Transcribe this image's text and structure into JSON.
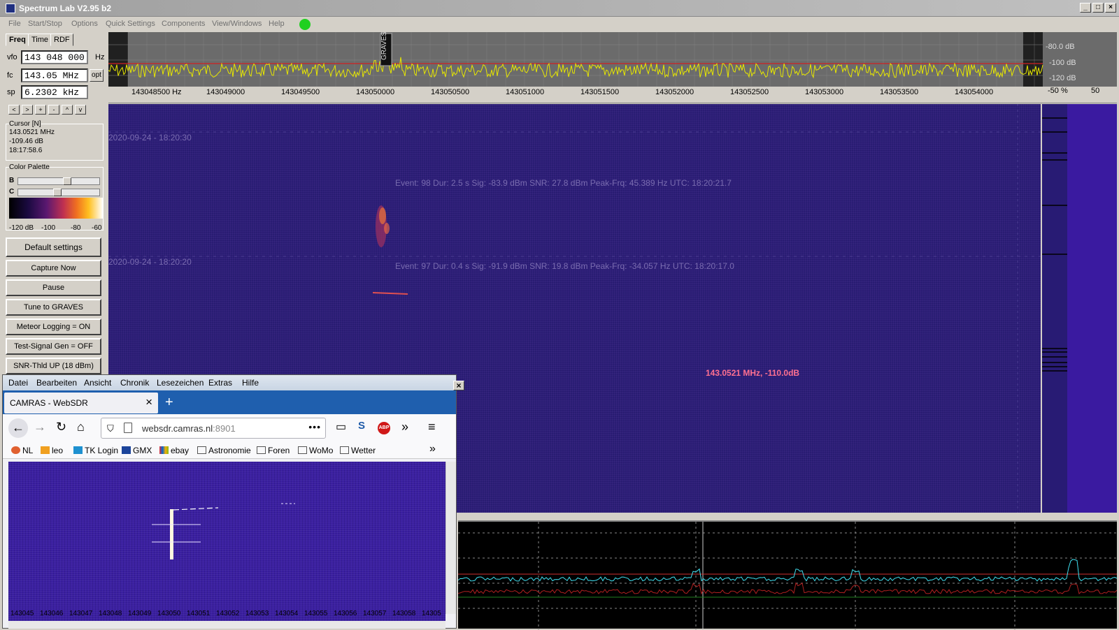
{
  "window": {
    "title": "Spectrum Lab V2.95 b2"
  },
  "menu": [
    "File",
    "Start/Stop",
    "Options",
    "Quick Settings",
    "Components",
    "View/Windows",
    "Help"
  ],
  "tabs": [
    "Freq",
    "Time",
    "RDF"
  ],
  "fields": {
    "vfo": {
      "label": "vfo",
      "value": "143 048 000",
      "unit": "Hz"
    },
    "fc": {
      "label": "fc",
      "value": "143.05 MHz",
      "opt": "opt"
    },
    "sp": {
      "label": "sp",
      "value": "6.2302 kHz"
    }
  },
  "nav_buttons": [
    "<",
    ">",
    "+",
    "-",
    "^",
    "v"
  ],
  "cursor": {
    "legend": "Cursor [N]",
    "freq": "143.0521 MHz",
    "level": "-109.46 dB",
    "time": "18:17:58.6"
  },
  "palette": {
    "legend": "Color Palette",
    "b_label": "B",
    "c_label": "C",
    "ticks": [
      "-120 dB",
      "-100",
      "-80",
      "-60"
    ]
  },
  "buttons": [
    "Default settings",
    "Capture Now",
    "Pause",
    "Tune to GRAVES",
    "Meteor Logging = ON",
    "Test-Signal Gen = OFF",
    "SNR-Thld UP (18 dBm)"
  ],
  "spectrum": {
    "marker": "GRAVES",
    "db_labels": [
      "-80.0 dB",
      "-100 dB",
      "-120 dB"
    ],
    "pct_label": "-50 %",
    "pct_value": "50"
  },
  "freq_ticks": [
    "143048500 Hz",
    "143049000",
    "143049500",
    "143050000",
    "143050500",
    "143051000",
    "143051500",
    "143052000",
    "143052500",
    "143053000",
    "143053500",
    "143054000"
  ],
  "waterfall": {
    "timestamps": [
      "2020-09-24 - 18:20:30",
      "2020-09-24 - 18:20:20"
    ],
    "events": [
      "Event: 98   Dur: 2.5 s   Sig: -83.9 dBm   SNR: 27.8 dBm   Peak-Frq: 45.389 Hz   UTC: 18:20:21.7",
      "Event: 97   Dur: 0.4 s   Sig: -91.9 dBm   SNR: 19.8 dBm   Peak-Frq: -34.057 Hz   UTC: 18:20:17.0"
    ],
    "cursor_readout": "143.0521 MHz, -110.0dB"
  },
  "browser": {
    "menu": [
      "Datei",
      "Bearbeiten",
      "Ansicht",
      "Chronik",
      "Lesezeichen",
      "Extras",
      "Hilfe"
    ],
    "tab_title": "CAMRAS - WebSDR",
    "url_host": "websdr.camras.nl",
    "url_port": ":8901",
    "bookmarks": [
      "NL",
      "leo",
      "TK Login",
      "GMX",
      "ebay",
      "Astronomie",
      "Foren",
      "WoMo",
      "Wetter"
    ],
    "axis_ticks": [
      "143045",
      "143046",
      "143047",
      "143048",
      "143049",
      "143050",
      "143051",
      "143052",
      "143053",
      "143054",
      "143055",
      "143056",
      "143057",
      "143058",
      "14305"
    ]
  },
  "colors": {
    "waterfall_bg": "#281b74",
    "spectrum_trace": "#e8e800",
    "cursor_text": "#ff7090",
    "browser_tab_strip": "#1f5fae"
  }
}
